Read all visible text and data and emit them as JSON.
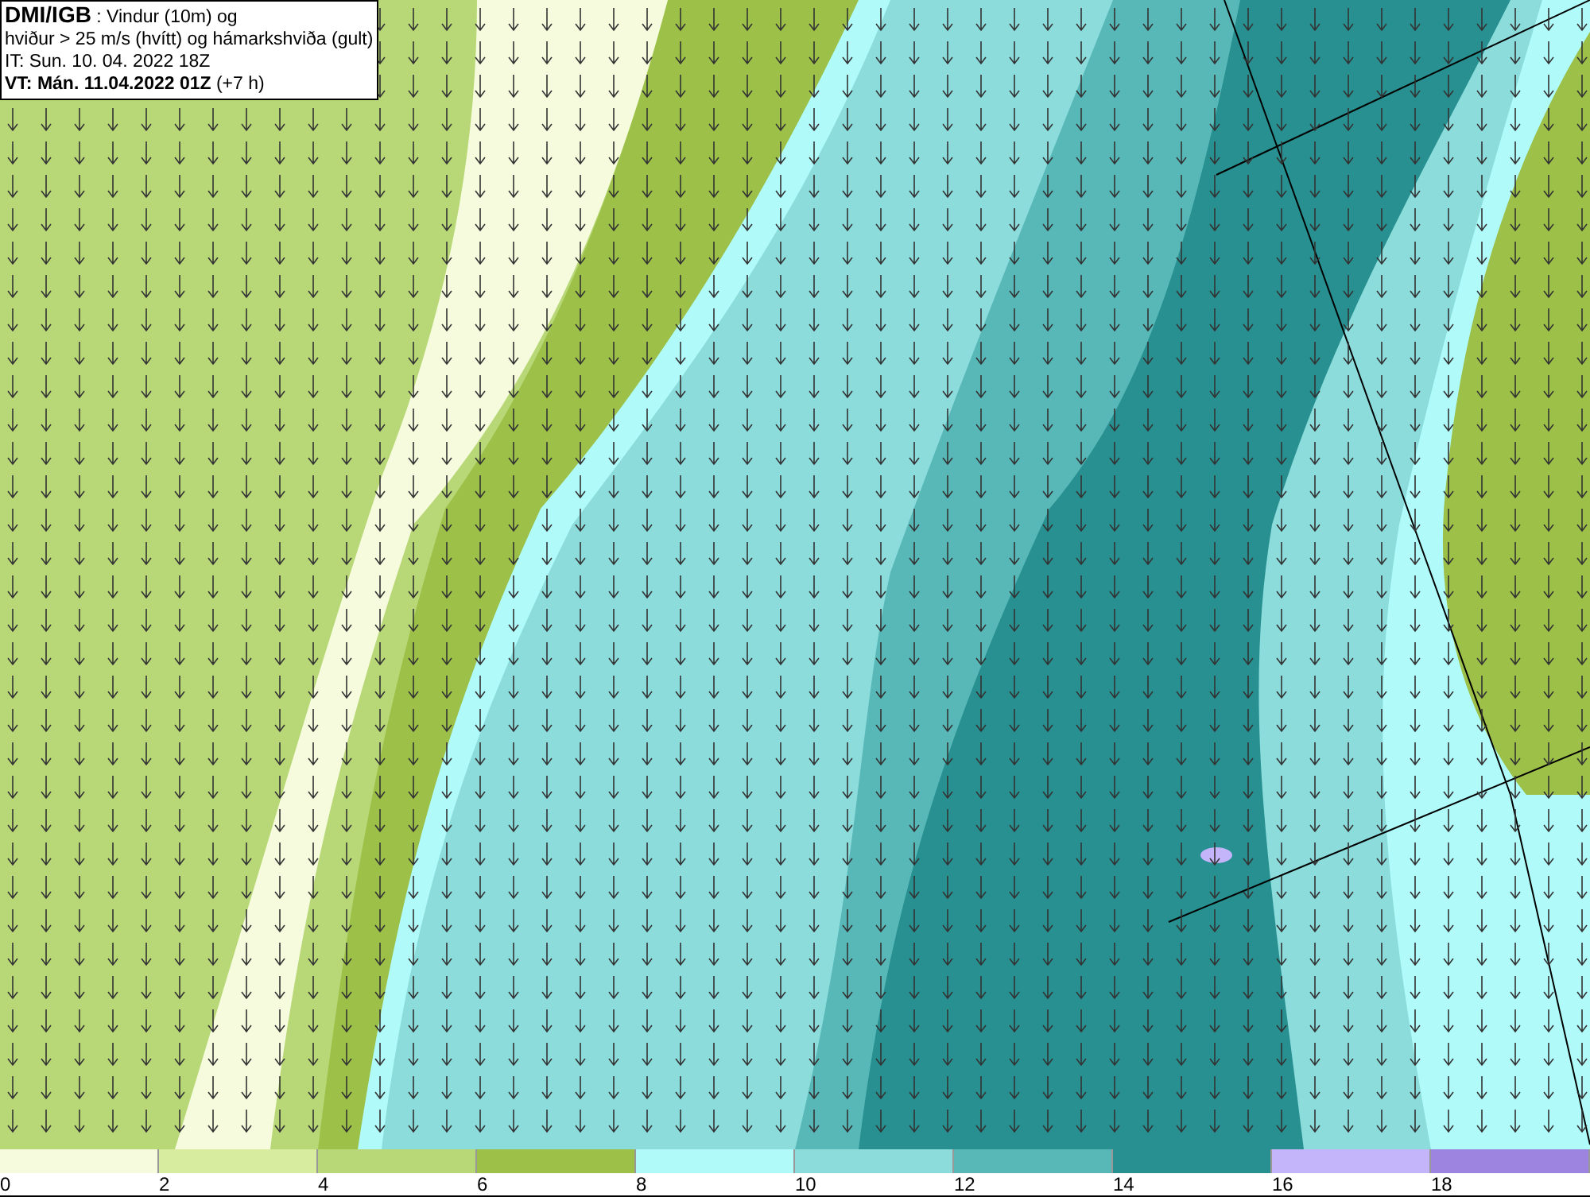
{
  "header": {
    "source": "DMI/IGB",
    "title_rest": " : Vindur (10m) og",
    "line_2": "hviður > 25 m/s (hvítt) og hámarkshviða (gult)",
    "issue_time": "IT: Sun. 10. 04. 2022 18Z",
    "valid_time": "VT: Mán. 11.04.2022 01Z",
    "offset": " (+7 h)"
  },
  "legend": [
    {
      "label": "0",
      "color": "#f5fbdc"
    },
    {
      "label": "2",
      "color": "#d8eca0"
    },
    {
      "label": "4",
      "color": "#b8d878"
    },
    {
      "label": "6",
      "color": "#9cc048"
    },
    {
      "label": "8",
      "color": "#b0fafa"
    },
    {
      "label": "10",
      "color": "#8cdcdc"
    },
    {
      "label": "12",
      "color": "#58b8b8"
    },
    {
      "label": "14",
      "color": "#289090"
    },
    {
      "label": "16",
      "color": "#c4b4fa"
    },
    {
      "label": "18",
      "color": "#9c84e0"
    }
  ]
}
